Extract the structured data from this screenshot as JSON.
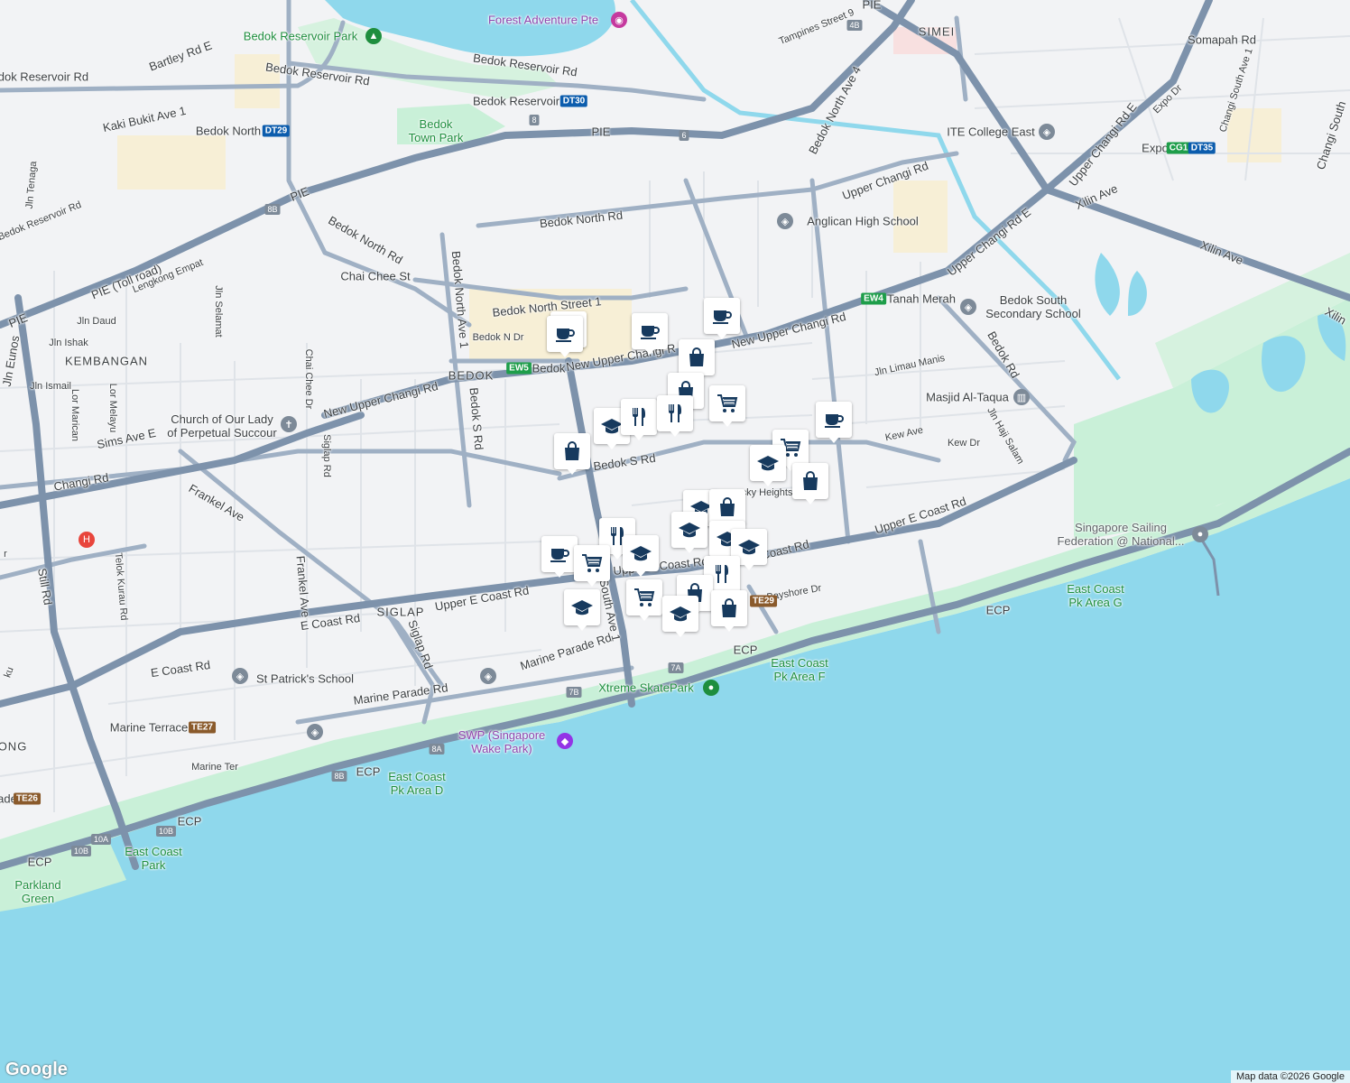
{
  "map": {
    "attribution": "Map data ©2026 Google",
    "logo": "Google",
    "colors": {
      "water": "#8fd8ec",
      "park": "#c9f0d8",
      "road": "#8fa4bd",
      "major_road": "#7d92ab",
      "land": "#f2f3f5",
      "pin_icon": "#173a5e"
    }
  },
  "labels": {
    "bedok_reservoir_park": "Bedok Reservoir Park",
    "forest_adventure": "Forest Adventure Pte",
    "bartley_rd_e": "Bartley Rd E",
    "bedok_reservoir_rd_1": "Bedok Reservoir Rd",
    "bedok_reservoir_rd_2": "Bedok Reservoir Rd",
    "bedok_reservoir_rd_3": "Bedok Reservoir Rd",
    "bedok_reservoir_stn": "Bedok Reservoir",
    "kaki_bukit": "Kaki Bukit Ave 1",
    "bedok_north_stn": "Bedok North",
    "bedok_town_park": "Bedok\nTown Park",
    "pie_1": "PIE",
    "pie_2": "PIE",
    "pie_3": "PIE",
    "pie_4": "PIE",
    "pie_toll": "PIE (Toll road)",
    "simei": "SIMEI",
    "tampines_st": "Tampines Street 9",
    "somapah": "Somapah Rd",
    "changi_south": "Changi South Ave 1",
    "changi_south_2": "Changi South",
    "expo_dr": "Expo Dr",
    "expo_stn": "Expo",
    "ite": "ITE College East",
    "bedok_north_ave_4": "Bedok North Ave 4",
    "upper_changi_rd": "Upper Changi Rd",
    "upper_changi_rd_e": "Upper Changi Rd E",
    "upper_changi_rd_e2": "Upper Changi Rd E",
    "xilin_ave": "Xilin Ave",
    "xilin_ave_2": "Xilin Ave",
    "xilin_3": "Xilin",
    "anglican": "Anglican High School",
    "bedok_north_rd": "Bedok North Rd",
    "bedok_north_rd_2": "Bedok North Rd",
    "bedok_reservoir_rd_w": "Bedok Reservoir Rd",
    "jln_tenaga": "Jln Tenaga",
    "chai_chee_st": "Chai Chee St",
    "bedok_north_st_1": "Bedok North Street 1",
    "bedok_north_ave_1": "Bedok North Ave 1",
    "bedok_n_dr": "Bedok N Dr",
    "lengkong": "Lengkong Empat",
    "jln_selamat": "Jln Selamat",
    "jln_daud": "Jln Daud",
    "jln_ishak": "Jln Ishak",
    "jln_eunos": "Jln Eunos",
    "kembangan": "KEMBANGAN",
    "bedok": "BEDOK",
    "bedok_stn": "Bedok",
    "new_upper_changi_1": "New Upper Changi Rd",
    "new_upper_changi_2": "New Upper Changi Rd",
    "new_upper_changi_3": "New Upper Changi R",
    "tanah_merah": "Tanah Merah",
    "bedok_south_sec": "Bedok South\nSecondary School",
    "jln_ismail": "Jln Ismail",
    "lor_maricam": "Lor Marican",
    "lor_melayu": "Lor Melayu",
    "chai_chee_dr": "Chai Chee Dr",
    "bedok_s_rd": "Bedok S Rd",
    "bedok_s_rd_2": "Bedok S Rd",
    "church": "Church of Our Lady\nof Perpetual Succour",
    "sims_ave_e": "Sims Ave E",
    "jln_limau_manis": "Jln Limau Manis",
    "masjid": "Masjid Al-Taqua",
    "bedok_rd": "Bedok Rd",
    "kew_ave": "Kew Ave",
    "kew_dr": "Kew Dr",
    "jln_haji_salam": "Jln Haji Salam",
    "changi_rd": "Changi Rd",
    "frankel_ave": "Frankel Ave",
    "frankel_ave_2": "Frankel Ave",
    "siglap_rd": "Siglap Rd",
    "siglap_rd_2": "Siglap Rd",
    "siglap": "SIGLAP",
    "upper_e_coast": "Upper E Coast Rd",
    "upper_e_coast_2": "Upper E Coast Rd",
    "upper_e_coast_3": "Upper E Coast Rd",
    "coast_rd": "Coast Rd",
    "e_coast_rd": "E Coast Rd",
    "e_coast_rd_2": "E Coast Rd",
    "telok_kurau": "Telok Kurau Rd",
    "still_rd": "Still Rd",
    "lucky_heights": "cky Heights",
    "bedok_south_ave": "South Ave 1",
    "marine_parade_rd": "Marine Parade Rd",
    "marine_parade_rd_2": "Marine Parade Rd",
    "st_patricks": "St Patrick's School",
    "marine_terrace": "Marine Terrace",
    "marine_ter": "Marine Ter",
    "ong": "ONG",
    "ade": "ade",
    "bayshore": "Bayshore Dr",
    "ecp_1": "ECP",
    "ecp_2": "ECP",
    "ecp_3": "ECP",
    "ecp_4": "ECP",
    "ecp_5": "ECP",
    "xtreme": "Xtreme SkatePark",
    "swp": "SWP (Singapore\nWake Park)",
    "ecp_area_d": "East Coast\nPk Area D",
    "ecp_area_f": "East Coast\nPk Area F",
    "ecp_area_g": "East Coast\nPk Area G",
    "east_coast_park": "East Coast\nPark",
    "parkland_green": "Parkland\nGreen",
    "sailing": "Singapore Sailing\nFederation @ National...",
    "edge_r": "r",
    "edge_ku": "ku"
  },
  "badges": {
    "ew5": "EW5",
    "ew4": "EW4",
    "dt30": "DT30",
    "dt29": "DT29",
    "dt35": "DT35",
    "cg1": "CG1",
    "te29": "TE29",
    "te27": "TE27",
    "te26": "TE26",
    "exit_4b": "4B",
    "exit_6": "6",
    "exit_8": "8",
    "exit_8b": "8B",
    "exit_8b2": "8B",
    "exit_7a": "7A",
    "exit_7b": "7B",
    "exit_8a": "8A",
    "exit_10a": "10A",
    "exit_10b": "10B",
    "exit_10b2": "10B"
  },
  "pins": [
    {
      "type": "cafe-icon"
    },
    {
      "type": "cafe-icon"
    },
    {
      "type": "cafe-icon"
    },
    {
      "type": "cafe-icon"
    },
    {
      "type": "shopping-bag-icon"
    },
    {
      "type": "shopping-bag-icon"
    },
    {
      "type": "school-icon"
    },
    {
      "type": "restaurant-icon"
    },
    {
      "type": "restaurant-icon"
    },
    {
      "type": "shopping-cart-icon"
    },
    {
      "type": "cafe-icon"
    },
    {
      "type": "shopping-bag-icon"
    },
    {
      "type": "shopping-cart-icon"
    },
    {
      "type": "school-icon"
    },
    {
      "type": "shopping-bag-icon"
    },
    {
      "type": "school-icon"
    },
    {
      "type": "shopping-bag-icon"
    },
    {
      "type": "school-icon"
    },
    {
      "type": "school-icon"
    },
    {
      "type": "school-icon"
    },
    {
      "type": "restaurant-icon"
    },
    {
      "type": "school-icon"
    },
    {
      "type": "cafe-icon"
    },
    {
      "type": "shopping-cart-icon"
    },
    {
      "type": "restaurant-icon"
    },
    {
      "type": "shopping-bag-icon"
    },
    {
      "type": "shopping-cart-icon"
    },
    {
      "type": "school-icon"
    },
    {
      "type": "school-icon"
    },
    {
      "type": "shopping-bag-icon"
    }
  ]
}
